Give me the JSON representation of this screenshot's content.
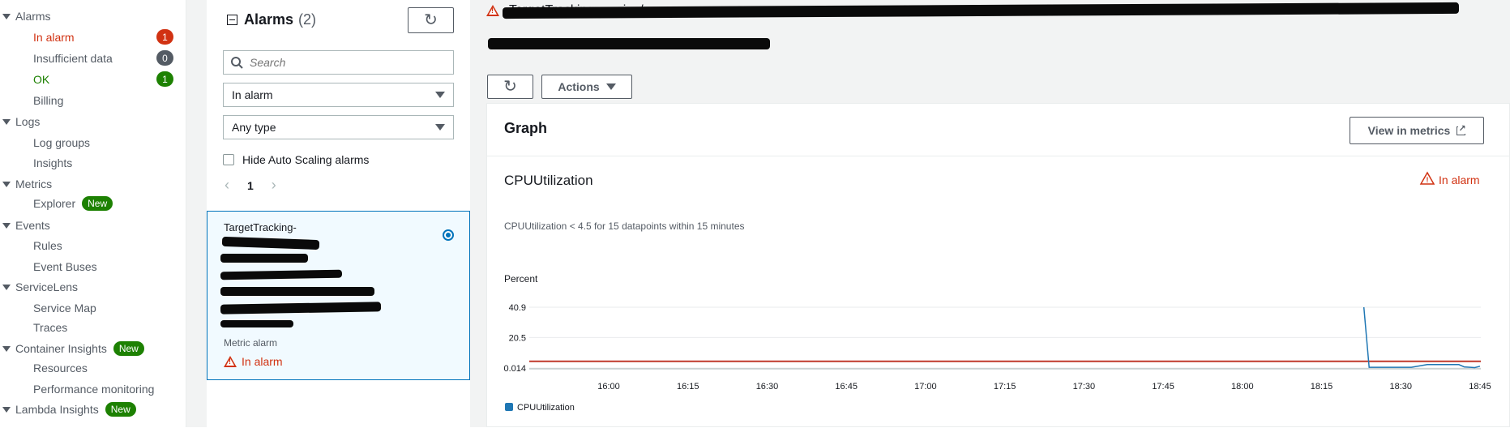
{
  "sidebar": {
    "sections": [
      {
        "label": "Alarms",
        "items": [
          {
            "label": "In alarm",
            "count": "1",
            "tone": "red",
            "badge_color": "#d13212"
          },
          {
            "label": "Insufficient data",
            "count": "0",
            "tone": "normal",
            "badge_color": "#545b64"
          },
          {
            "label": "OK",
            "count": "1",
            "tone": "green",
            "badge_color": "#1d8102"
          },
          {
            "label": "Billing"
          }
        ]
      },
      {
        "label": "Logs",
        "items": [
          {
            "label": "Log groups"
          },
          {
            "label": "Insights"
          }
        ]
      },
      {
        "label": "Metrics",
        "items": [
          {
            "label": "Explorer",
            "badge": "New"
          }
        ]
      },
      {
        "label": "Events",
        "items": [
          {
            "label": "Rules"
          },
          {
            "label": "Event Buses"
          }
        ]
      },
      {
        "label": "ServiceLens",
        "items": [
          {
            "label": "Service Map"
          },
          {
            "label": "Traces"
          }
        ]
      },
      {
        "label": "Container Insights",
        "badge": "New",
        "items": [
          {
            "label": "Resources"
          },
          {
            "label": "Performance monitoring"
          }
        ]
      },
      {
        "label": "Lambda Insights",
        "badge": "New",
        "items": []
      }
    ]
  },
  "alarm_list": {
    "title": "Alarms",
    "count": "(2)",
    "search_placeholder": "Search",
    "state_filter": "In alarm",
    "type_filter": "Any type",
    "hide_autoscaling_label": "Hide Auto Scaling alarms",
    "page": "1",
    "card": {
      "name_first_line": "TargetTracking-",
      "type": "Metric alarm",
      "state": "In alarm"
    }
  },
  "detail": {
    "title_prefix": "TargetTracking-service/",
    "actions_label": "Actions",
    "graph": {
      "heading": "Graph",
      "view_in_metrics": "View in metrics",
      "metric_title": "CPUUtilization",
      "state": "In alarm",
      "condition": "CPUUtilization < 4.5 for 15 datapoints within 15 minutes"
    }
  },
  "colors": {
    "alarm_red": "#d13212",
    "ok_green": "#1d8102",
    "link_blue": "#0073bb",
    "series_blue": "#1f77b4",
    "threshold_red": "#c0392b"
  },
  "chart_data": {
    "type": "line",
    "ylabel": "Percent",
    "y_ticks": [
      "40.9",
      "20.5",
      "0.014"
    ],
    "ylim": [
      0.014,
      40.9
    ],
    "x_ticks": [
      "16:00",
      "16:15",
      "16:30",
      "16:45",
      "17:00",
      "17:15",
      "17:30",
      "17:45",
      "18:00",
      "18:15",
      "18:30",
      "18:45"
    ],
    "grid": true,
    "legend_position": "bottom-left",
    "threshold": 4.5,
    "series": [
      {
        "name": "CPUUtilization",
        "color": "#1f77b4",
        "x": [
          "18:23",
          "18:24",
          "18:25",
          "18:27",
          "18:29",
          "18:32",
          "18:35",
          "18:37",
          "18:39",
          "18:41",
          "18:42",
          "18:44",
          "18:45"
        ],
        "values": [
          40.9,
          0.5,
          0.5,
          0.5,
          0.5,
          0.5,
          2.3,
          2.3,
          2.3,
          2.3,
          0.8,
          0.3,
          1.2
        ]
      }
    ]
  }
}
